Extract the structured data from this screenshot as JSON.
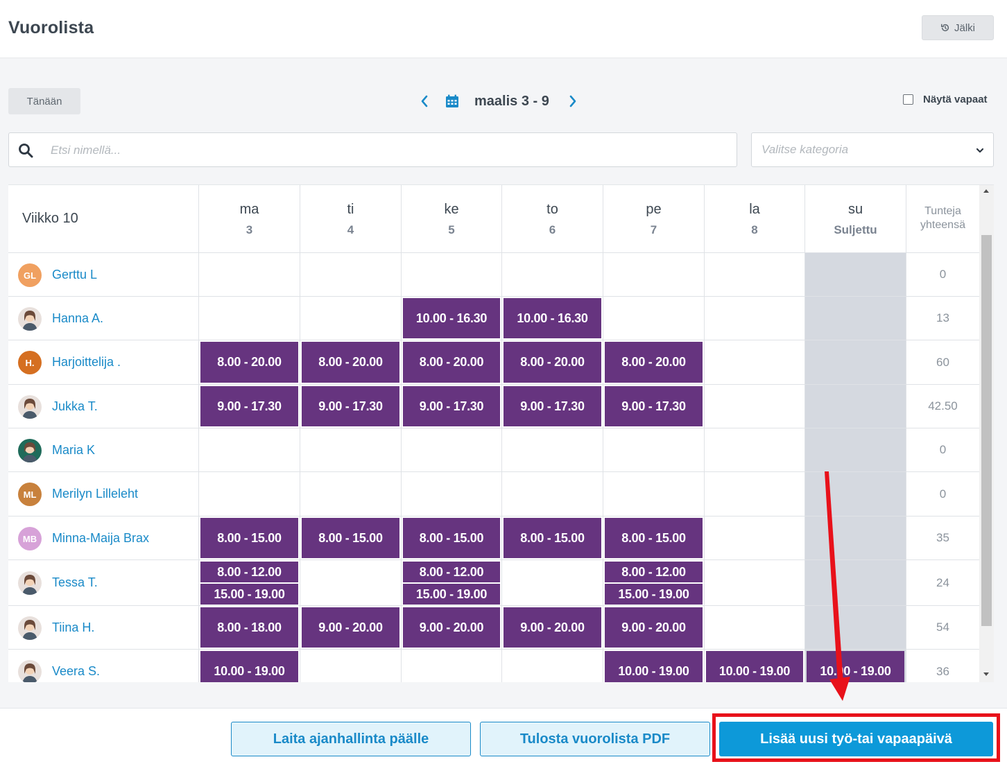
{
  "header": {
    "title": "Vuorolista",
    "back_label": "Jälki"
  },
  "toolbar": {
    "today_label": "Tänään",
    "date_range": "maalis 3 - 9",
    "show_free_label": "Näytä vapaat"
  },
  "search": {
    "placeholder": "Etsi nimellä...",
    "value": ""
  },
  "category": {
    "placeholder": "Valitse kategoria"
  },
  "table": {
    "week_label": "Viikko 10",
    "days": [
      {
        "day": "ma",
        "date": "3"
      },
      {
        "day": "ti",
        "date": "4"
      },
      {
        "day": "ke",
        "date": "5"
      },
      {
        "day": "to",
        "date": "6"
      },
      {
        "day": "pe",
        "date": "7"
      },
      {
        "day": "la",
        "date": "8"
      },
      {
        "day": "su",
        "date": "Suljettu"
      }
    ],
    "total_header_line1": "Tunteja",
    "total_header_line2": "yhteensä",
    "employees": [
      {
        "name": "Gerttu L",
        "avatar": "GL",
        "avatar_color": "#f0a060",
        "total": "0",
        "shifts": [
          [],
          [],
          [],
          [],
          [],
          [],
          []
        ]
      },
      {
        "name": "Hanna A.",
        "avatar": "",
        "avatar_color": "#e8e0dc",
        "total": "13",
        "shifts": [
          [],
          [],
          [
            "10.00 - 16.30"
          ],
          [
            "10.00 - 16.30"
          ],
          [],
          [],
          []
        ]
      },
      {
        "name": "Harjoittelija .",
        "avatar": "H.",
        "avatar_color": "#d56f21",
        "total": "60",
        "shifts": [
          [
            "8.00 - 20.00"
          ],
          [
            "8.00 - 20.00"
          ],
          [
            "8.00 - 20.00"
          ],
          [
            "8.00 - 20.00"
          ],
          [
            "8.00 - 20.00"
          ],
          [],
          []
        ]
      },
      {
        "name": "Jukka T.",
        "avatar": "",
        "avatar_color": "#e8e0dc",
        "total": "42.50",
        "shifts": [
          [
            "9.00 - 17.30"
          ],
          [
            "9.00 - 17.30"
          ],
          [
            "9.00 - 17.30"
          ],
          [
            "9.00 - 17.30"
          ],
          [
            "9.00 - 17.30"
          ],
          [],
          []
        ]
      },
      {
        "name": "Maria K",
        "avatar": "",
        "avatar_color": "#1f6b5a",
        "total": "0",
        "shifts": [
          [],
          [],
          [],
          [],
          [],
          [],
          []
        ]
      },
      {
        "name": "Merilyn Lilleleht",
        "avatar": "ML",
        "avatar_color": "#c8813c",
        "total": "0",
        "shifts": [
          [],
          [],
          [],
          [],
          [],
          [],
          []
        ]
      },
      {
        "name": "Minna-Maija Brax",
        "avatar": "MB",
        "avatar_color": "#d7a2d8",
        "total": "35",
        "shifts": [
          [
            "8.00 - 15.00"
          ],
          [
            "8.00 - 15.00"
          ],
          [
            "8.00 - 15.00"
          ],
          [
            "8.00 - 15.00"
          ],
          [
            "8.00 - 15.00"
          ],
          [],
          []
        ]
      },
      {
        "name": "Tessa T.",
        "avatar": "",
        "avatar_color": "#e8e0dc",
        "total": "24",
        "shifts": [
          [
            "8.00 - 12.00",
            "15.00 - 19.00"
          ],
          [],
          [
            "8.00 - 12.00",
            "15.00 - 19.00"
          ],
          [],
          [
            "8.00 - 12.00",
            "15.00 - 19.00"
          ],
          [],
          []
        ]
      },
      {
        "name": "Tiina H.",
        "avatar": "",
        "avatar_color": "#e8e0dc",
        "total": "54",
        "shifts": [
          [
            "8.00 - 18.00"
          ],
          [
            "9.00 - 20.00"
          ],
          [
            "9.00 - 20.00"
          ],
          [
            "9.00 - 20.00"
          ],
          [
            "9.00 - 20.00"
          ],
          [],
          []
        ]
      },
      {
        "name": "Veera S.",
        "avatar": "",
        "avatar_color": "#e8e0dc",
        "total": "36",
        "shifts": [
          [
            "10.00 - 19.00"
          ],
          [],
          [],
          [],
          [
            "10.00 - 19.00"
          ],
          [
            "10.00 - 19.00"
          ],
          [
            "10.00 - 19.00"
          ]
        ]
      }
    ]
  },
  "footer": {
    "time_tracking_label": "Laita ajanhallinta päälle",
    "print_pdf_label": "Tulosta vuorolista PDF",
    "add_day_label": "Lisää uusi työ-tai vapaapäivä"
  },
  "colors": {
    "accent": "#0d99d9",
    "shift": "#66347f",
    "link": "#1a8ac8",
    "closed_day": "#d5d9e0",
    "annotation": "#e8111a"
  }
}
